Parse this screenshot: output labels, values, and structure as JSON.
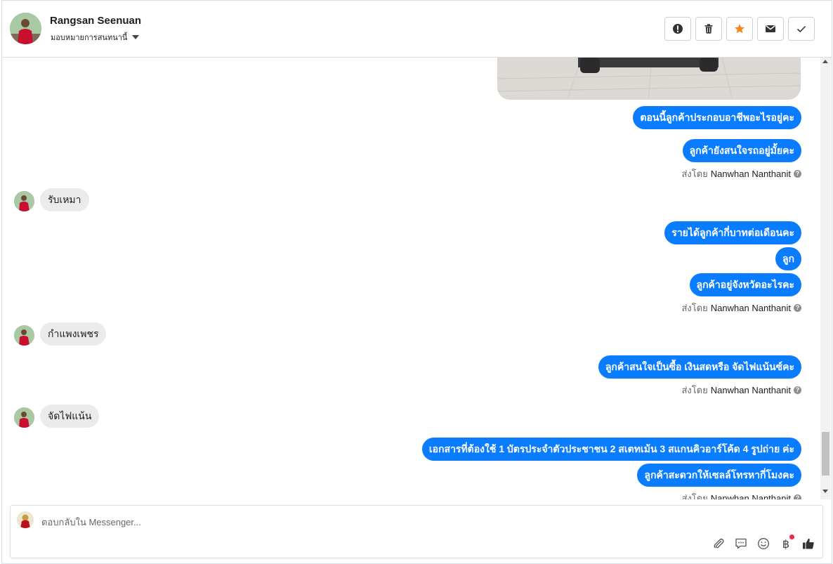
{
  "header": {
    "contact_name": "Rangsan Seenuan",
    "assign_label": "มอบหมายการสนทนานี้",
    "actions": [
      {
        "name": "report-button",
        "icon": "alert-icon"
      },
      {
        "name": "delete-button",
        "icon": "trash-icon"
      },
      {
        "name": "star-button",
        "icon": "star-icon"
      },
      {
        "name": "mark-unread-button",
        "icon": "envelope-icon"
      },
      {
        "name": "mark-done-button",
        "icon": "check-icon"
      }
    ]
  },
  "messages": {
    "out1": "ตอนนี้ลูกค้าประกอบอาชีพอะไรอยู่คะ",
    "out2": "ลูกค้ายังสนใจรถอยู่มั้ยคะ",
    "in1": "รับเหมา",
    "out3": "รายได้ลูกค้ากี่บาทต่อเดือนคะ",
    "out4": "ลูก",
    "out5": "ลูกค้าอยู่จังหวัดอะไรคะ",
    "in2": "กำแพงเพชร",
    "out6": "ลูกค้าสนใจเป็นซื้อ เงินสดหรือ จัดไฟแน้นซ์คะ",
    "in3": "จัดไฟแน้น",
    "out7": "เอกสารที่ต้องใช้ 1 บัตรประจำตัวประชาชน 2 สเตทเม้น 3 สแกนคิวอาร์โค้ด 4 รูปถ่าย ค่ะ",
    "out8": "ลูกค้าสะดวกให้เซลล์โทรหากี่โมงคะ"
  },
  "sent_by": {
    "prefix": "ส่งโดย",
    "agent": "Nanwhan Nanthanit",
    "help": "?"
  },
  "composer": {
    "placeholder": "ตอบกลับใน Messenger...",
    "currency_symbol": "฿"
  },
  "colors": {
    "outgoing_bubble": "#0a7cff",
    "incoming_bubble": "#ebebeb",
    "star": "#f08b1d",
    "notification_dot": "#f02849"
  }
}
